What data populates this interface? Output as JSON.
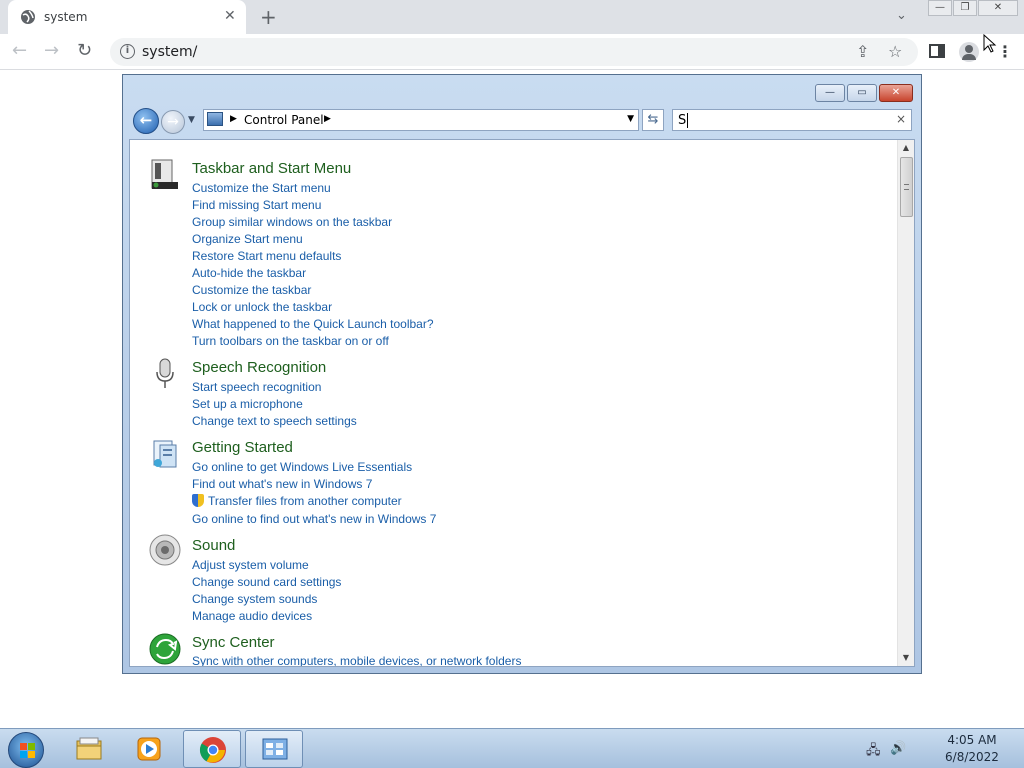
{
  "browser": {
    "tab_title": "system",
    "tab_close": "✕",
    "new_tab": "+",
    "url": "system/",
    "window_minimize": "—",
    "window_restore": "❐",
    "window_close": "✕"
  },
  "explorer": {
    "breadcrumb": "Control Panel",
    "search_value": "S",
    "search_clear": "×",
    "caption_minimize": "—",
    "caption_maximize": "▭",
    "caption_close": "✕"
  },
  "groups": [
    {
      "title": "Taskbar and Start Menu",
      "icon": "taskbar-icon",
      "links": [
        "Customize the Start menu",
        "Find missing Start menu",
        "Group similar windows on the taskbar",
        "Organize Start menu",
        "Restore Start menu defaults",
        "Auto-hide the taskbar",
        "Customize the taskbar",
        "Lock or unlock the taskbar",
        "What happened to the Quick Launch toolbar?",
        "Turn toolbars on the taskbar on or off"
      ]
    },
    {
      "title": "Speech Recognition",
      "icon": "microphone-icon",
      "links": [
        "Start speech recognition",
        "Set up a microphone",
        "Change text to speech settings"
      ]
    },
    {
      "title": "Getting Started",
      "icon": "getting-started-icon",
      "links": [
        "Go online to get Windows Live Essentials",
        "Find out what's new in Windows 7",
        "Transfer files from another computer",
        "Go online to find out what's new in Windows 7"
      ]
    },
    {
      "title": "Sound",
      "icon": "speaker-icon",
      "links": [
        "Adjust system volume",
        "Change sound card settings",
        "Change system sounds",
        "Manage audio devices"
      ]
    },
    {
      "title": "Sync Center",
      "icon": "sync-icon",
      "links": [
        "Sync with other computers, mobile devices, or network folders"
      ]
    }
  ],
  "taskbar": {
    "time": "4:05 AM",
    "date": "6/8/2022",
    "pinned": [
      "explorer-folder-icon",
      "media-player-icon",
      "chrome-icon",
      "control-panel-icon"
    ]
  },
  "colors": {
    "link": "#1a5ea8",
    "group_title": "#1e5f1e",
    "window_frame": "#b7cde8"
  }
}
